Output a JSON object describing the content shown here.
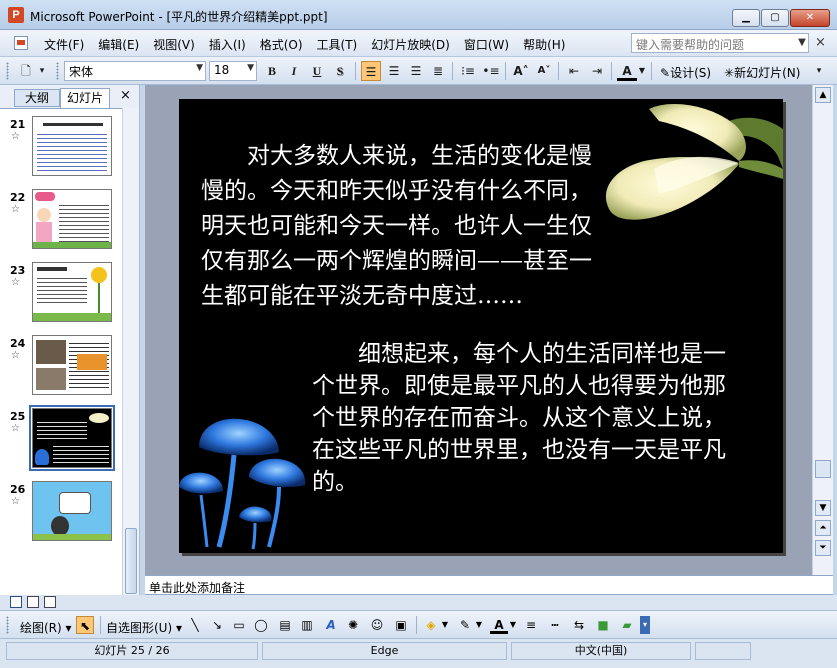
{
  "window": {
    "app_name": "Microsoft PowerPoint",
    "title": "Microsoft PowerPoint - [平凡的世界介绍精美ppt.ppt]",
    "min_label": "▁",
    "max_label": "▢",
    "close_label": "✕"
  },
  "menu": {
    "items": [
      "文件(F)",
      "编辑(E)",
      "视图(V)",
      "插入(I)",
      "格式(O)",
      "工具(T)",
      "幻灯片放映(D)",
      "窗口(W)",
      "帮助(H)"
    ],
    "help_placeholder": "键入需要帮助的问题",
    "close_label": "×"
  },
  "toolbar": {
    "font_name": "宋体",
    "font_size": "18",
    "bold": "B",
    "italic": "I",
    "underline": "U",
    "shadow": "S",
    "design_label": "设计(S)",
    "new_slide_label": "新幻灯片(N)"
  },
  "left_panel": {
    "tab_outline": "大纲",
    "tab_slides": "幻灯片",
    "close_label": "×",
    "slides": [
      {
        "number": "21",
        "star": "☆"
      },
      {
        "number": "22",
        "star": "☆"
      },
      {
        "number": "23",
        "star": "☆"
      },
      {
        "number": "24",
        "star": "☆"
      },
      {
        "number": "25",
        "star": "☆"
      },
      {
        "number": "26",
        "star": "☆"
      }
    ]
  },
  "slide": {
    "paragraph1": "对大多数人来说，生活的变化是慢慢的。今天和昨天似乎没有什么不同，明天也可能和今天一样。也许人一生仅仅有那么一两个辉煌的瞬间——甚至一生都可能在平淡无奇中度过……",
    "paragraph2": "细想起来，每个人的生活同样也是一个世界。即使是最平凡的人也得要为他那个世界的存在而奋斗。从这个意义上说，在这些平凡的世界里，也没有一天是平凡的。"
  },
  "notes": {
    "placeholder": "单击此处添加备注"
  },
  "drawing_toolbar": {
    "draw_label": "绘图(R)",
    "autoshapes_label": "自选图形(U)"
  },
  "status": {
    "slide_position": "幻灯片 25 / 26",
    "design_name": "Edge",
    "language": "中文(中国)"
  },
  "colors": {
    "slide_background": "#000000",
    "slide_text": "#ffffff",
    "selection_outline": "#3b6bb3"
  }
}
